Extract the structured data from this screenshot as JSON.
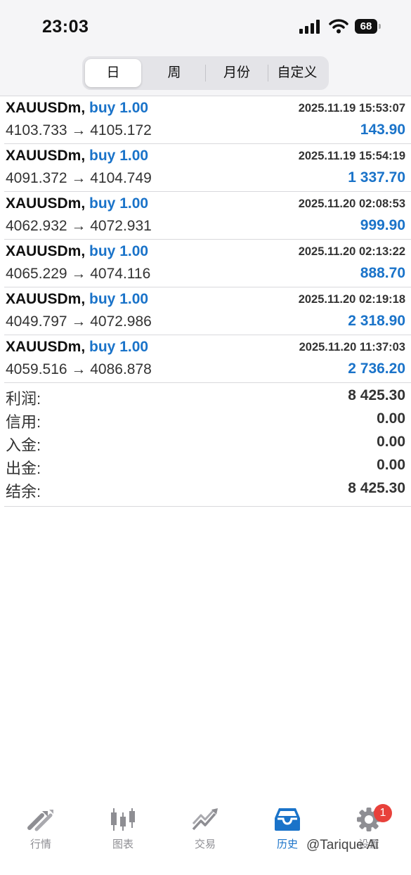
{
  "status_bar": {
    "time": "23:03",
    "battery": "68"
  },
  "period_tabs": [
    {
      "label": "日",
      "active": true
    },
    {
      "label": "周",
      "active": false
    },
    {
      "label": "月份",
      "active": false
    },
    {
      "label": "自定义",
      "active": false
    }
  ],
  "trades": [
    {
      "symbol": "XAUUSDm,",
      "side": "buy 1.00",
      "datetime": "2025.11.19 15:53:07",
      "prices": "4103.733 → 4105.172",
      "profit": "143.90"
    },
    {
      "symbol": "XAUUSDm,",
      "side": "buy 1.00",
      "datetime": "2025.11.19 15:54:19",
      "prices": "4091.372 → 4104.749",
      "profit": "1 337.70"
    },
    {
      "symbol": "XAUUSDm,",
      "side": "buy 1.00",
      "datetime": "2025.11.20 02:08:53",
      "prices": "4062.932 → 4072.931",
      "profit": "999.90"
    },
    {
      "symbol": "XAUUSDm,",
      "side": "buy 1.00",
      "datetime": "2025.11.20 02:13:22",
      "prices": "4065.229 → 4074.116",
      "profit": "888.70"
    },
    {
      "symbol": "XAUUSDm,",
      "side": "buy 1.00",
      "datetime": "2025.11.20 02:19:18",
      "prices": "4049.797 → 4072.986",
      "profit": "2 318.90"
    },
    {
      "symbol": "XAUUSDm,",
      "side": "buy 1.00",
      "datetime": "2025.11.20 11:37:03",
      "prices": "4059.516 → 4086.878",
      "profit": "2 736.20"
    }
  ],
  "summary": [
    {
      "label": "利润:",
      "value": "8 425.30"
    },
    {
      "label": "信用:",
      "value": "0.00"
    },
    {
      "label": "入金:",
      "value": "0.00"
    },
    {
      "label": "出金:",
      "value": "0.00"
    },
    {
      "label": "结余:",
      "value": "8 425.30"
    }
  ],
  "tab_bar": {
    "items": [
      {
        "label": "行情",
        "icon": "quotes-arrows-icon"
      },
      {
        "label": "图表",
        "icon": "candlestick-chart-icon"
      },
      {
        "label": "交易",
        "icon": "trade-trend-icon"
      },
      {
        "label": "历史",
        "icon": "history-inbox-icon",
        "active": true
      },
      {
        "label": "设置",
        "icon": "gear-icon",
        "badge": "1"
      }
    ]
  },
  "watermark": "@Tarique Ai",
  "colors": {
    "accent": "#1a73c9",
    "badge": "#e8413b",
    "text": "#111111",
    "muted": "#8e8e93"
  }
}
